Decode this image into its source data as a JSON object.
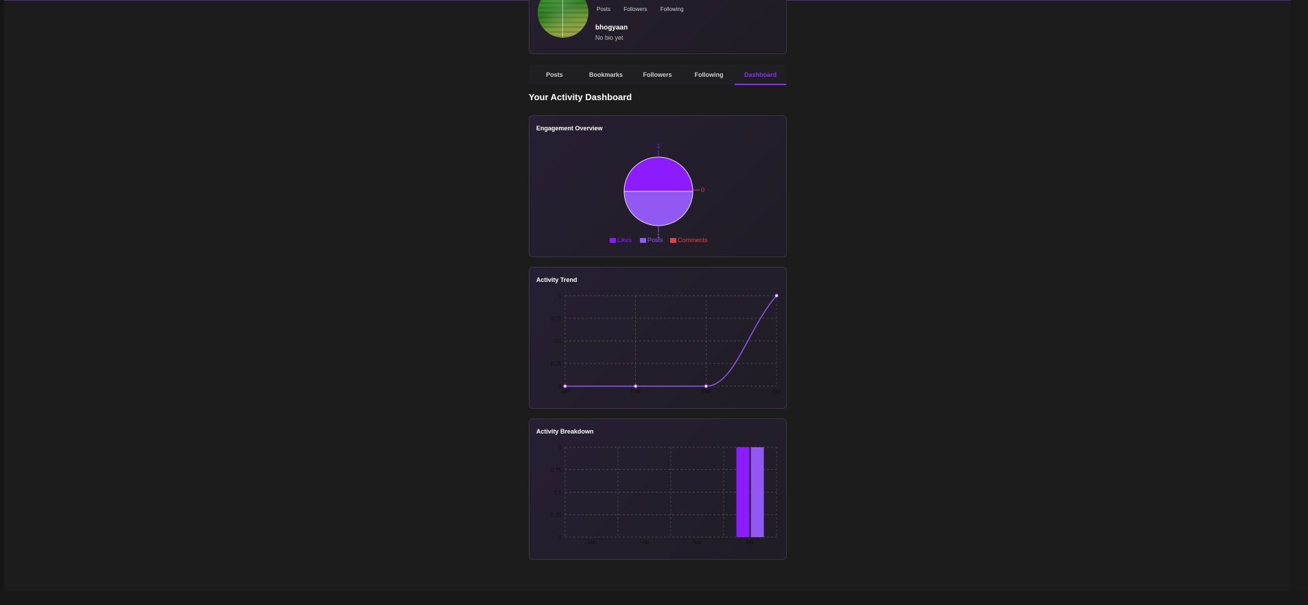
{
  "profile": {
    "stats": [
      "Posts",
      "Followers",
      "Following"
    ],
    "username": "bhogyaan",
    "bio": "No bio yet"
  },
  "tabs": [
    {
      "label": "Posts",
      "active": false
    },
    {
      "label": "Bookmarks",
      "active": false
    },
    {
      "label": "Followers",
      "active": false
    },
    {
      "label": "Following",
      "active": false
    },
    {
      "label": "Dashboard",
      "active": true
    }
  ],
  "dashboard": {
    "title": "Your Activity Dashboard"
  },
  "colors": {
    "accent": "#8c2cff",
    "likes": "#8c1cff",
    "posts": "#9158f2",
    "comments": "#e04545"
  },
  "chart_data": [
    {
      "type": "pie",
      "title": "Engagement Overview",
      "labels": [
        "Likes",
        "Posts",
        "Comments"
      ],
      "values": [
        1,
        1,
        0
      ],
      "legend": "bottom"
    },
    {
      "type": "line",
      "title": "Activity Trend",
      "x": [
        "Jan",
        "Feb",
        "Mar",
        "Apr"
      ],
      "series": [
        {
          "values": [
            0,
            0,
            0,
            1
          ]
        }
      ],
      "yticks": [
        "0",
        "0.25",
        "0.5",
        "0.75",
        "1"
      ],
      "ylim": [
        0,
        1
      ],
      "grid": true
    },
    {
      "type": "bar",
      "title": "Activity Breakdown",
      "categories": [
        "Jan",
        "Feb",
        "Mar",
        "Apr"
      ],
      "series": [
        {
          "values": [
            0,
            0,
            0,
            1
          ]
        },
        {
          "values": [
            0,
            0,
            0,
            1
          ]
        }
      ],
      "yticks": [
        "0",
        "0.25",
        "0.5",
        "0.75",
        "1"
      ],
      "ylim": [
        0,
        1
      ],
      "grid": true
    }
  ]
}
